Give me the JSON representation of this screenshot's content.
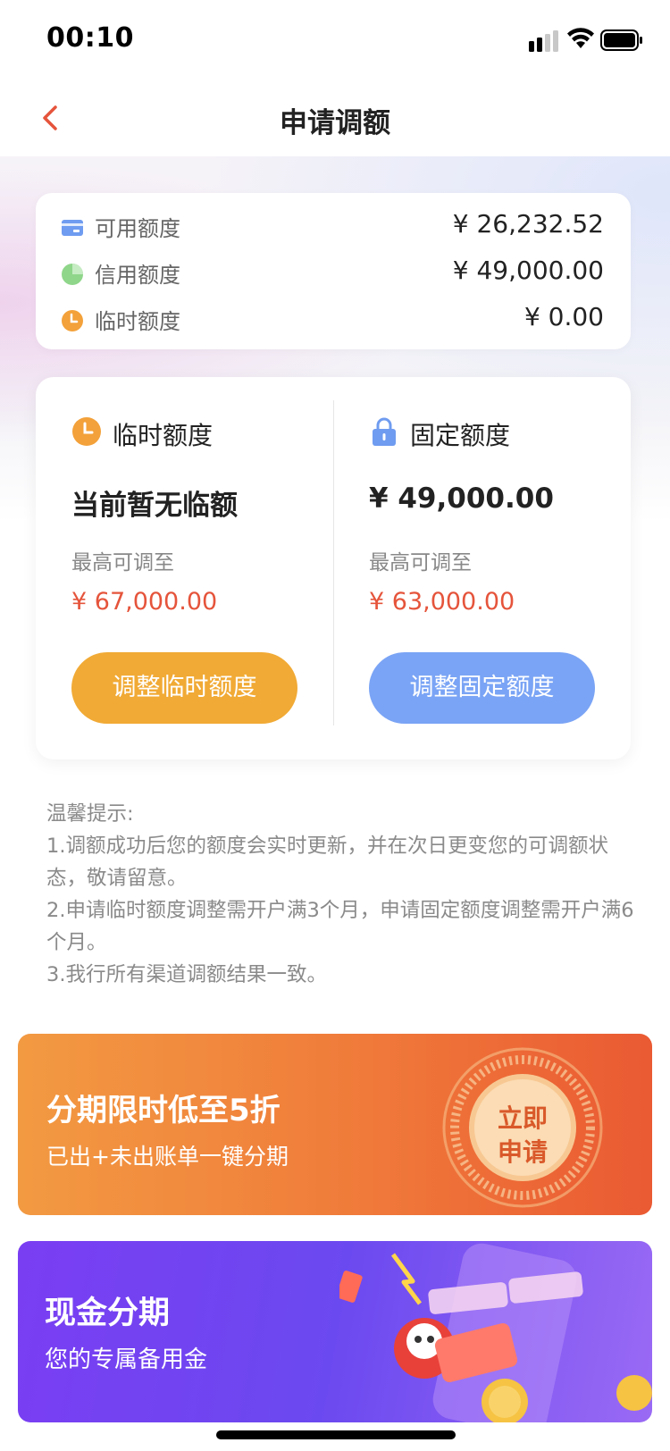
{
  "status_bar": {
    "time": "00:10"
  },
  "nav": {
    "title": "申请调额"
  },
  "summary": [
    {
      "label": "可用额度",
      "value": "¥ 26,232.52",
      "icon": "card-icon"
    },
    {
      "label": "信用额度",
      "value": "¥ 49,000.00",
      "icon": "pie-icon"
    },
    {
      "label": "临时额度",
      "value": "¥ 0.00",
      "icon": "clock-icon"
    }
  ],
  "temporary": {
    "title": "临时额度",
    "current": "当前暂无临额",
    "max_label": "最高可调至",
    "max_value": "¥ 67,000.00",
    "button": "调整临时额度"
  },
  "fixed": {
    "title": "固定额度",
    "current": "¥ 49,000.00",
    "max_label": "最高可调至",
    "max_value": "¥ 63,000.00",
    "button": "调整固定额度"
  },
  "tips": {
    "title": "温馨提示:",
    "items": [
      "1.调额成功后您的额度会实时更新，并在次日更变您的可调额状态，敬请留意。",
      "2.申请临时额度调整需开户满3个月，申请固定额度调整需开户满6个月。",
      "3.我行所有渠道调额结果一致。"
    ]
  },
  "banner_installment": {
    "title": "分期限时低至5折",
    "subtitle": "已出+未出账单一键分期",
    "badge_line1": "立即",
    "badge_line2": "申请"
  },
  "banner_cash": {
    "title": "现金分期",
    "subtitle": "您的专属备用金"
  },
  "colors": {
    "accent_red": "#e5543b",
    "orange_button": "#f1aa35",
    "blue_button": "#7aa4f5"
  }
}
